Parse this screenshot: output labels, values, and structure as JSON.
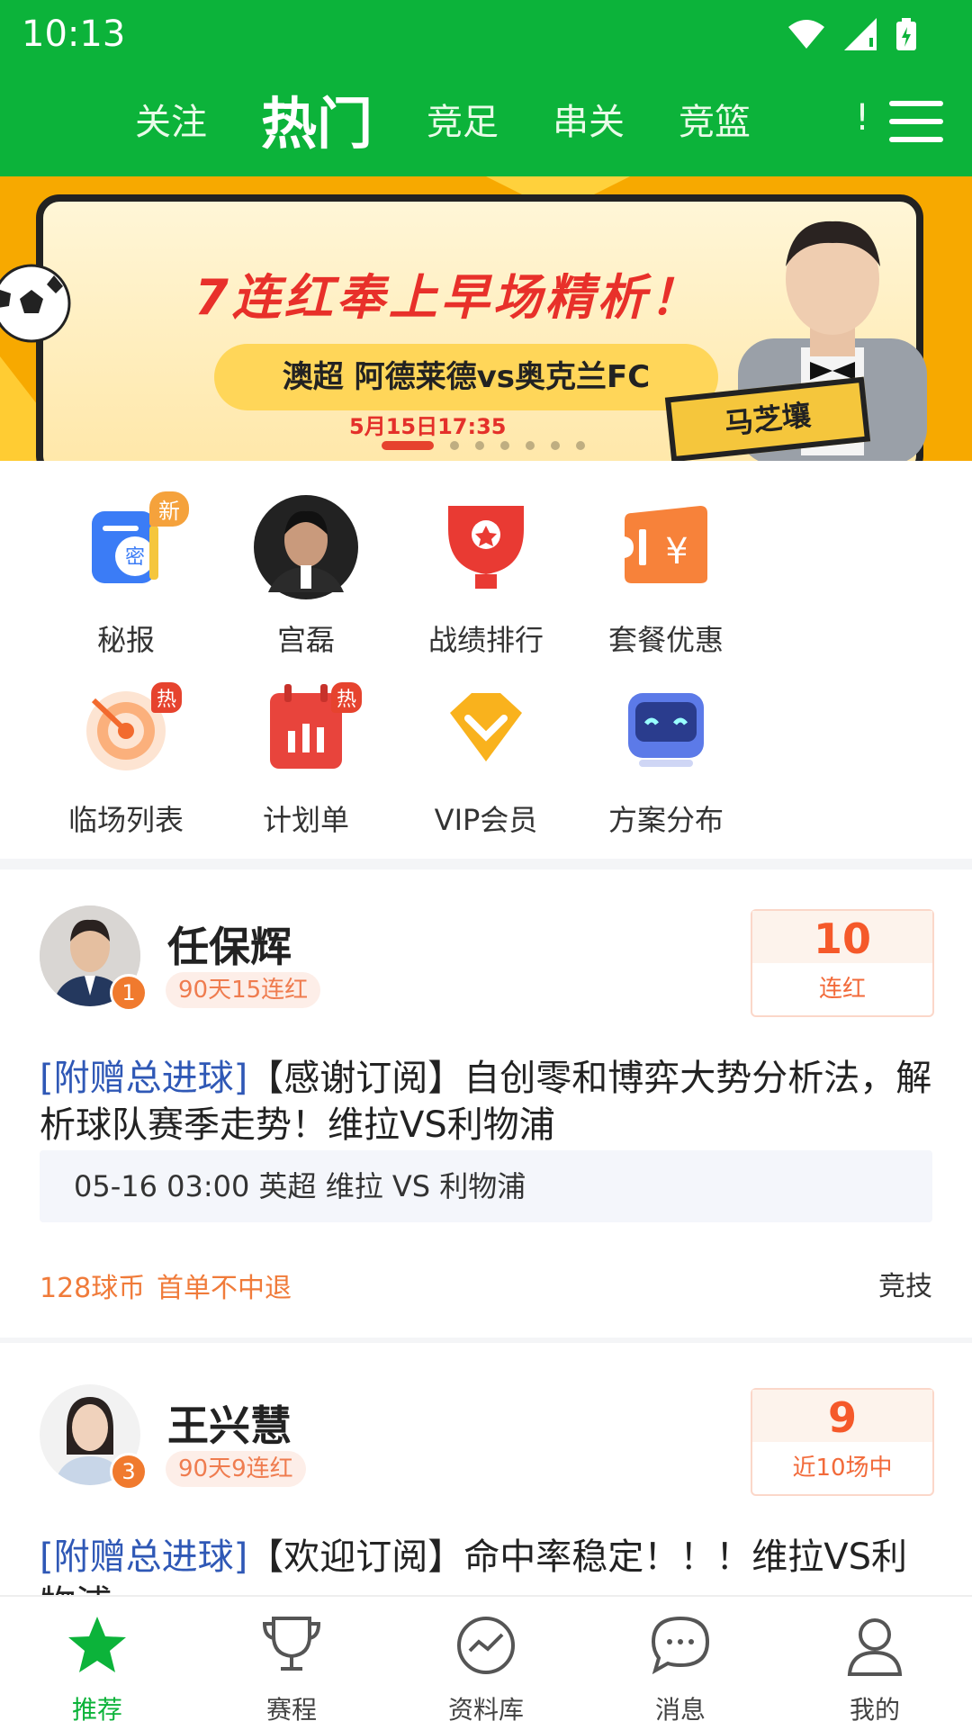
{
  "status_bar": {
    "time": "10:13"
  },
  "tabs": [
    {
      "label": "关注",
      "active": false
    },
    {
      "label": "热门",
      "active": true
    },
    {
      "label": "竞足",
      "active": false
    },
    {
      "label": "串关",
      "active": false
    },
    {
      "label": "竞篮",
      "active": false
    }
  ],
  "tab_more": "!",
  "banner": {
    "title": "7连红奉上早场精析！",
    "match": "澳超 阿德莱德vs奥克兰FC",
    "date": "5月15日17:35",
    "name": "马芝壤"
  },
  "grid": [
    {
      "label": "秘报",
      "badge": "新",
      "icon": "secret-report-icon"
    },
    {
      "label": "宫磊",
      "badge": "",
      "icon": "avatar"
    },
    {
      "label": "战绩排行",
      "badge": "",
      "icon": "trophy-ranking-icon"
    },
    {
      "label": "套餐优惠",
      "badge": "",
      "icon": "coupon-icon"
    },
    {
      "label": "临场列表",
      "badge": "热",
      "icon": "target-icon"
    },
    {
      "label": "计划单",
      "badge": "热",
      "icon": "plan-calendar-icon"
    },
    {
      "label": "VIP会员",
      "badge": "",
      "icon": "vip-diamond-icon"
    },
    {
      "label": "方案分布",
      "badge": "",
      "icon": "robot-icon"
    }
  ],
  "cards": [
    {
      "name": "任保辉",
      "rank": "1",
      "streak": "90天15连红",
      "stat_num": "10",
      "stat_label": "连红",
      "tag": "[附赠总进球]",
      "title": "【感谢订阅】自创零和博弈大势分析法，解析球队赛季走势！维拉VS利物浦",
      "match": "05-16 03:00  英超 维拉 VS 利物浦",
      "price": "128球币",
      "refund": "首单不中退",
      "category": "竞技"
    },
    {
      "name": "王兴慧",
      "rank": "3",
      "streak": "90天9连红",
      "stat_num": "9",
      "stat_label": "近10场中",
      "tag": "[附赠总进球]",
      "title": "【欢迎订阅】命中率稳定！！！维拉VS利物浦"
    }
  ],
  "bottom_nav": [
    {
      "label": "推荐",
      "active": true
    },
    {
      "label": "赛程",
      "active": false
    },
    {
      "label": "资料库",
      "active": false
    },
    {
      "label": "消息",
      "active": false
    },
    {
      "label": "我的",
      "active": false
    }
  ],
  "colors": {
    "brand_green": "#0cb33a",
    "accent_orange": "#f07b3a",
    "tag_blue": "#2f58b6"
  }
}
